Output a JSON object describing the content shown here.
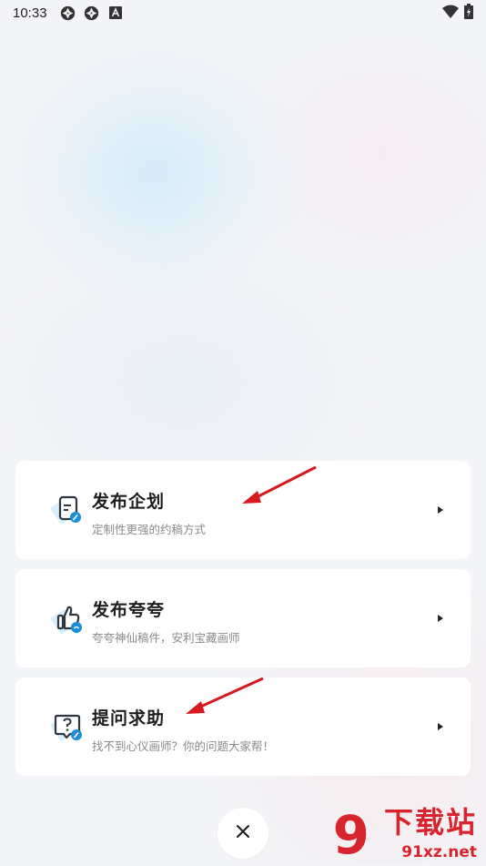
{
  "status_bar": {
    "time": "10:33",
    "icons": [
      "aperture-icon",
      "aperture-icon",
      "font-a-icon"
    ],
    "right_icons": [
      "wifi-icon",
      "battery-charging-icon"
    ]
  },
  "cards": [
    {
      "title": "发布企划",
      "subtitle": "定制性更强的约稿方式",
      "icon": "document-edit-icon"
    },
    {
      "title": "发布夸夸",
      "subtitle": "夸夸神仙稿件，安利宝藏画师",
      "icon": "thumbs-up-icon"
    },
    {
      "title": "提问求助",
      "subtitle": "找不到心仪画师？你的问题大家帮！",
      "icon": "question-chat-icon"
    }
  ],
  "close_button": {
    "icon": "close-icon"
  },
  "watermark": {
    "logo": "9",
    "text": "下载站",
    "url": "91xz.net"
  },
  "colors": {
    "accent": "#1a8fd8",
    "icon_bg": "#d8eefa",
    "annotation": "#d7191f",
    "watermark": "#d8242c"
  }
}
